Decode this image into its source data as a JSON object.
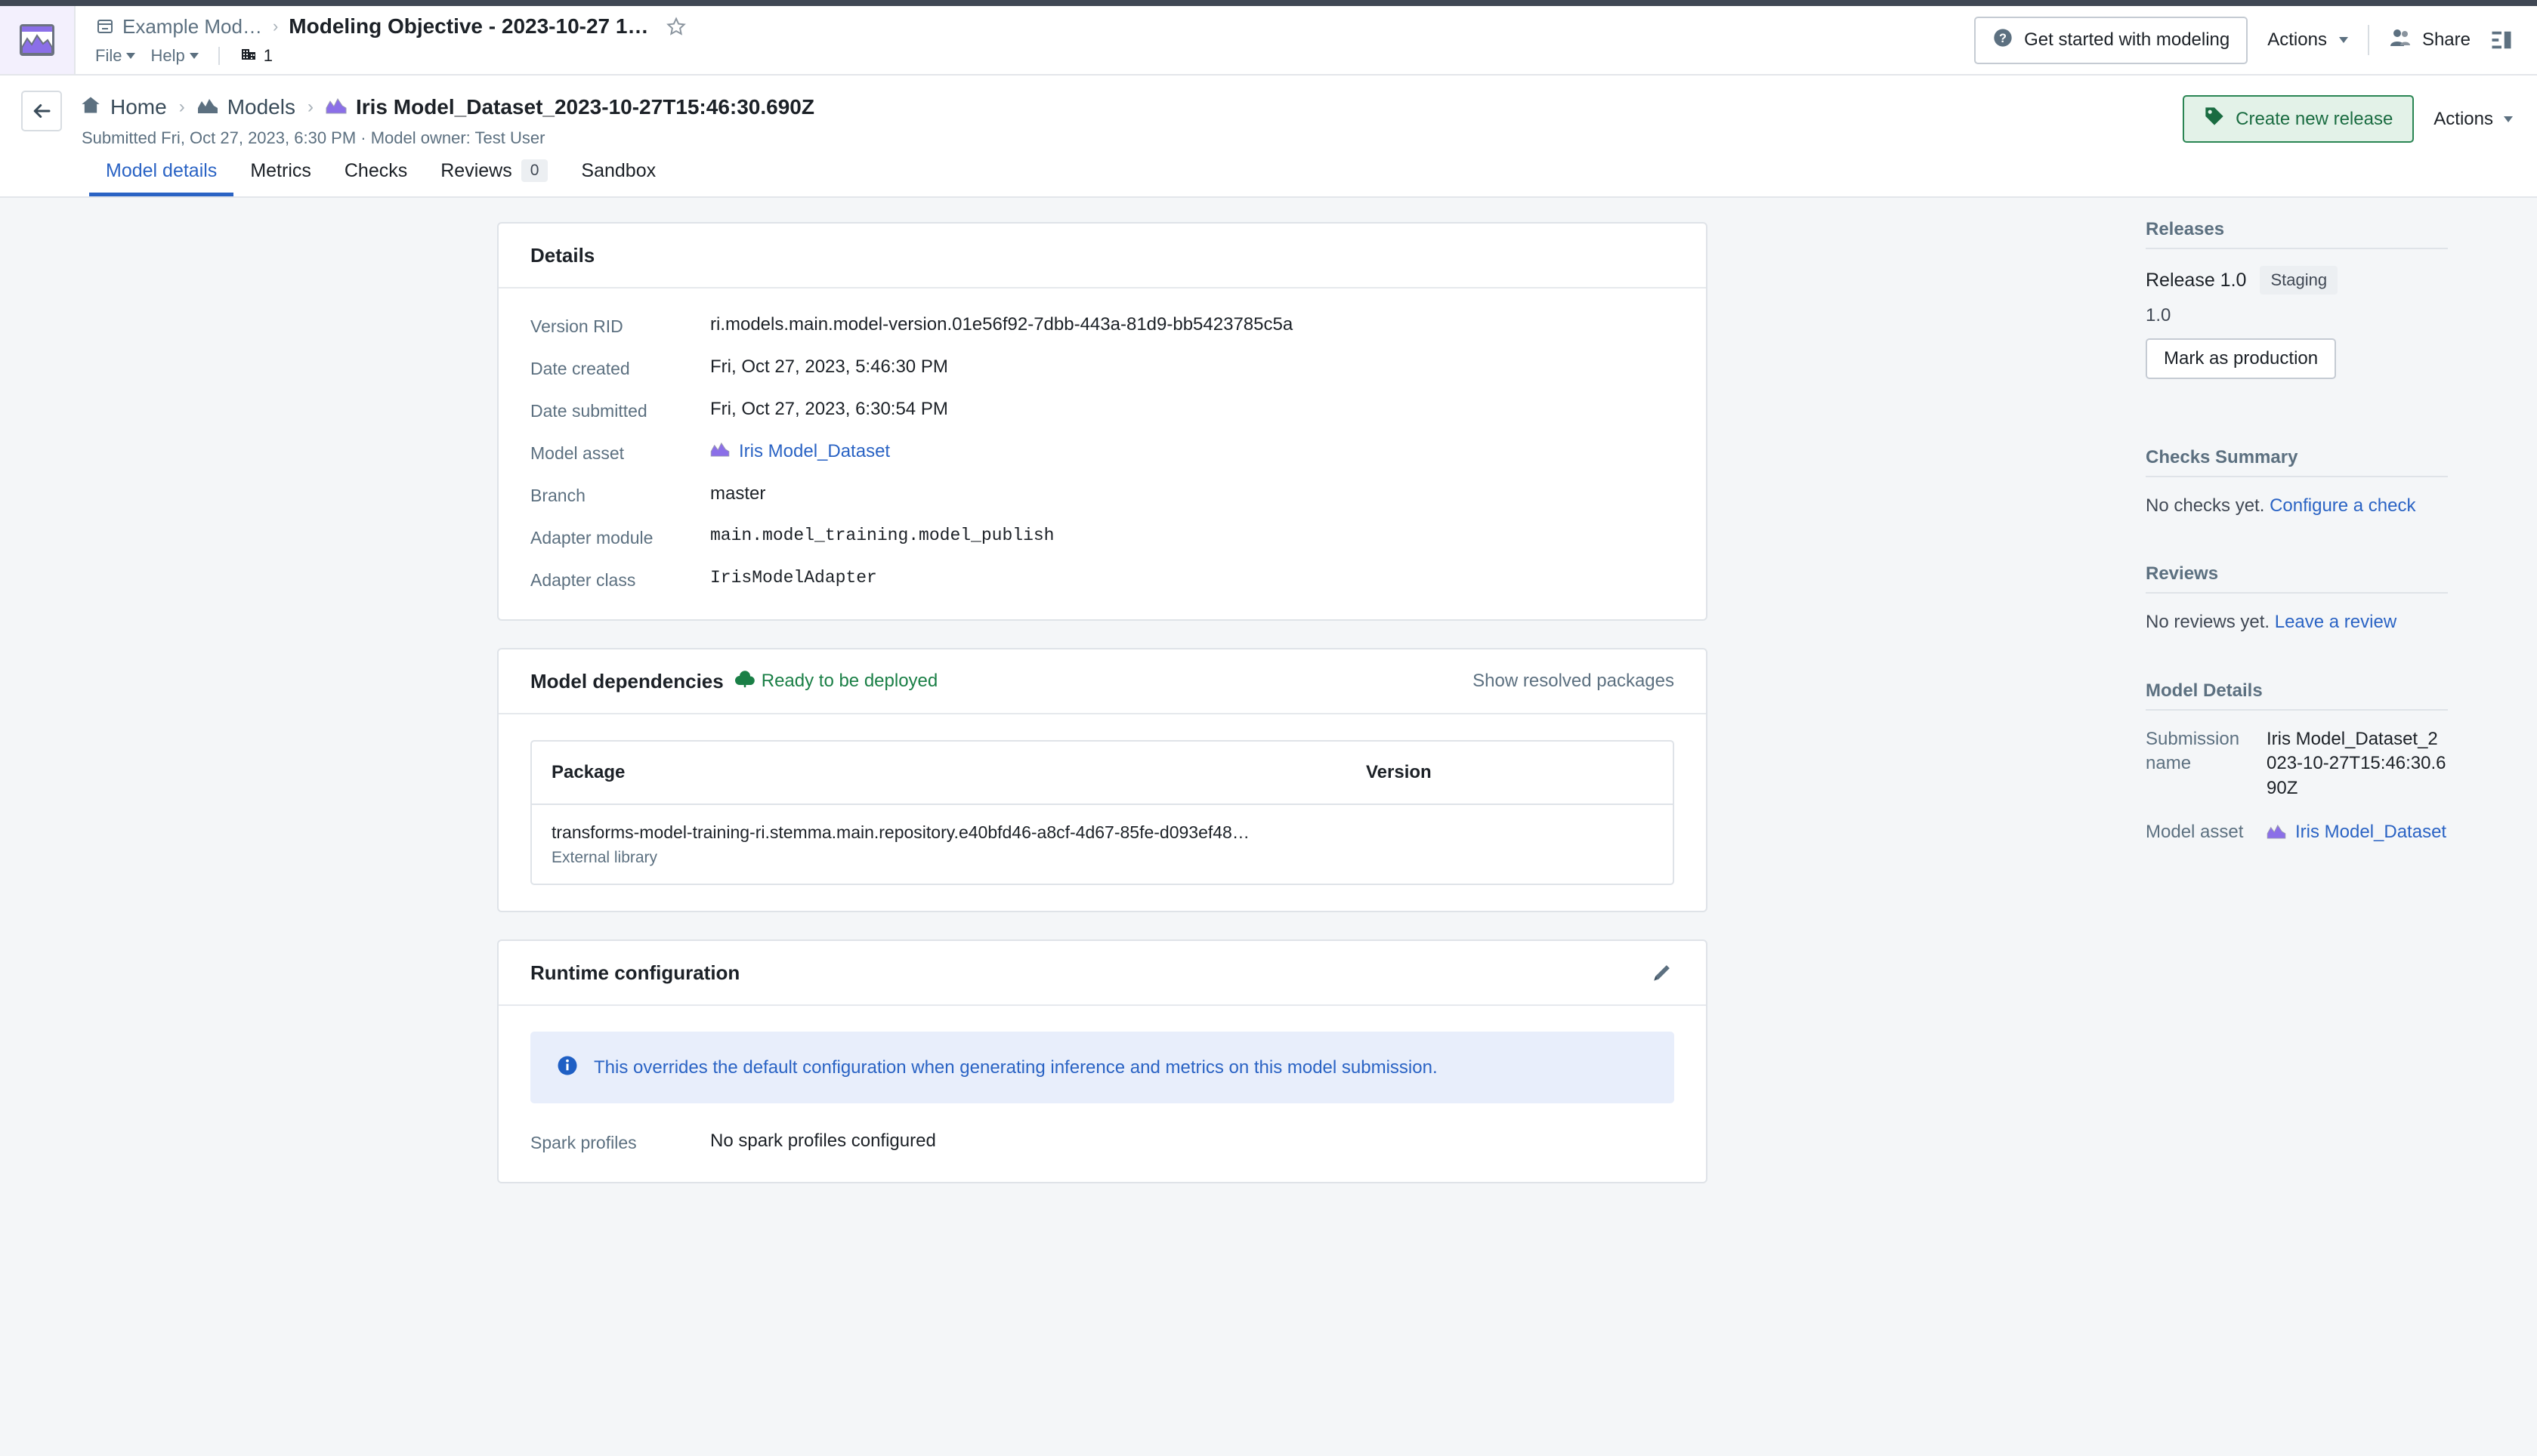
{
  "header": {
    "breadcrumb_parent": "Example Mod…",
    "breadcrumb_separator": "›",
    "title": "Modeling Objective - 2023-10-27 1…",
    "menu": {
      "file": "File",
      "help": "Help",
      "org_count": "1"
    },
    "get_started_label": "Get started with modeling",
    "actions_label": "Actions",
    "share_label": "Share"
  },
  "nav": {
    "home": "Home",
    "models": "Models",
    "current": "Iris Model_Dataset_2023-10-27T15:46:30.690Z",
    "separator": "›",
    "submitted_line": "Submitted Fri, Oct 27, 2023, 6:30 PM · Model owner: Test User",
    "create_release_label": "Create new release",
    "actions_label": "Actions"
  },
  "tabs": [
    {
      "label": "Model details",
      "active": true,
      "badge": ""
    },
    {
      "label": "Metrics",
      "active": false,
      "badge": ""
    },
    {
      "label": "Checks",
      "active": false,
      "badge": ""
    },
    {
      "label": "Reviews",
      "active": false,
      "badge": "0"
    },
    {
      "label": "Sandbox",
      "active": false,
      "badge": ""
    }
  ],
  "details_card": {
    "title": "Details",
    "rows": [
      {
        "key": "Version RID",
        "value": "ri.models.main.model-version.01e56f92-7dbb-443a-81d9-bb5423785c5a",
        "style": "plain"
      },
      {
        "key": "Date created",
        "value": "Fri, Oct 27, 2023, 5:46:30 PM",
        "style": "plain"
      },
      {
        "key": "Date submitted",
        "value": "Fri, Oct 27, 2023, 6:30:54 PM",
        "style": "plain"
      },
      {
        "key": "Model asset",
        "value": "Iris Model_Dataset",
        "style": "link"
      },
      {
        "key": "Branch",
        "value": "master",
        "style": "plain"
      },
      {
        "key": "Adapter module",
        "value": "main.model_training.model_publish",
        "style": "mono"
      },
      {
        "key": "Adapter class",
        "value": "IrisModelAdapter",
        "style": "mono"
      }
    ]
  },
  "dependencies_card": {
    "title": "Model dependencies",
    "status": "Ready to be deployed",
    "show_resolved_label": "Show resolved packages",
    "columns": [
      "Package",
      "Version"
    ],
    "rows": [
      {
        "package": "transforms-model-training-ri.stemma.main.repository.e40bfd46-a8cf-4d67-85fe-d093ef48…",
        "subtitle": "External library",
        "version": ""
      }
    ]
  },
  "runtime_card": {
    "title": "Runtime configuration",
    "info": "This overrides the default configuration when generating inference and metrics on this model submission.",
    "rows": [
      {
        "key": "Spark profiles",
        "value": "No spark profiles configured"
      }
    ]
  },
  "sidebar": {
    "releases": {
      "heading": "Releases",
      "release_name": "Release 1.0",
      "release_chip": "Staging",
      "release_version": "1.0",
      "mark_production_label": "Mark as production"
    },
    "checks": {
      "heading": "Checks Summary",
      "empty_text": "No checks yet. ",
      "link": "Configure a check"
    },
    "reviews": {
      "heading": "Reviews",
      "empty_text": "No reviews yet. ",
      "link": "Leave a review"
    },
    "model_details": {
      "heading": "Model Details",
      "submission_key": "Submission name",
      "submission_value": "Iris Model_Dataset_2023-10-27T15:46:30.690Z",
      "asset_key": "Model asset",
      "asset_value": "Iris Model_Dataset"
    }
  },
  "colors": {
    "accent_blue": "#2a63c4",
    "green": "#1a7f46",
    "purple": "#8b6fe8",
    "page_bg": "#f4f6f8"
  }
}
